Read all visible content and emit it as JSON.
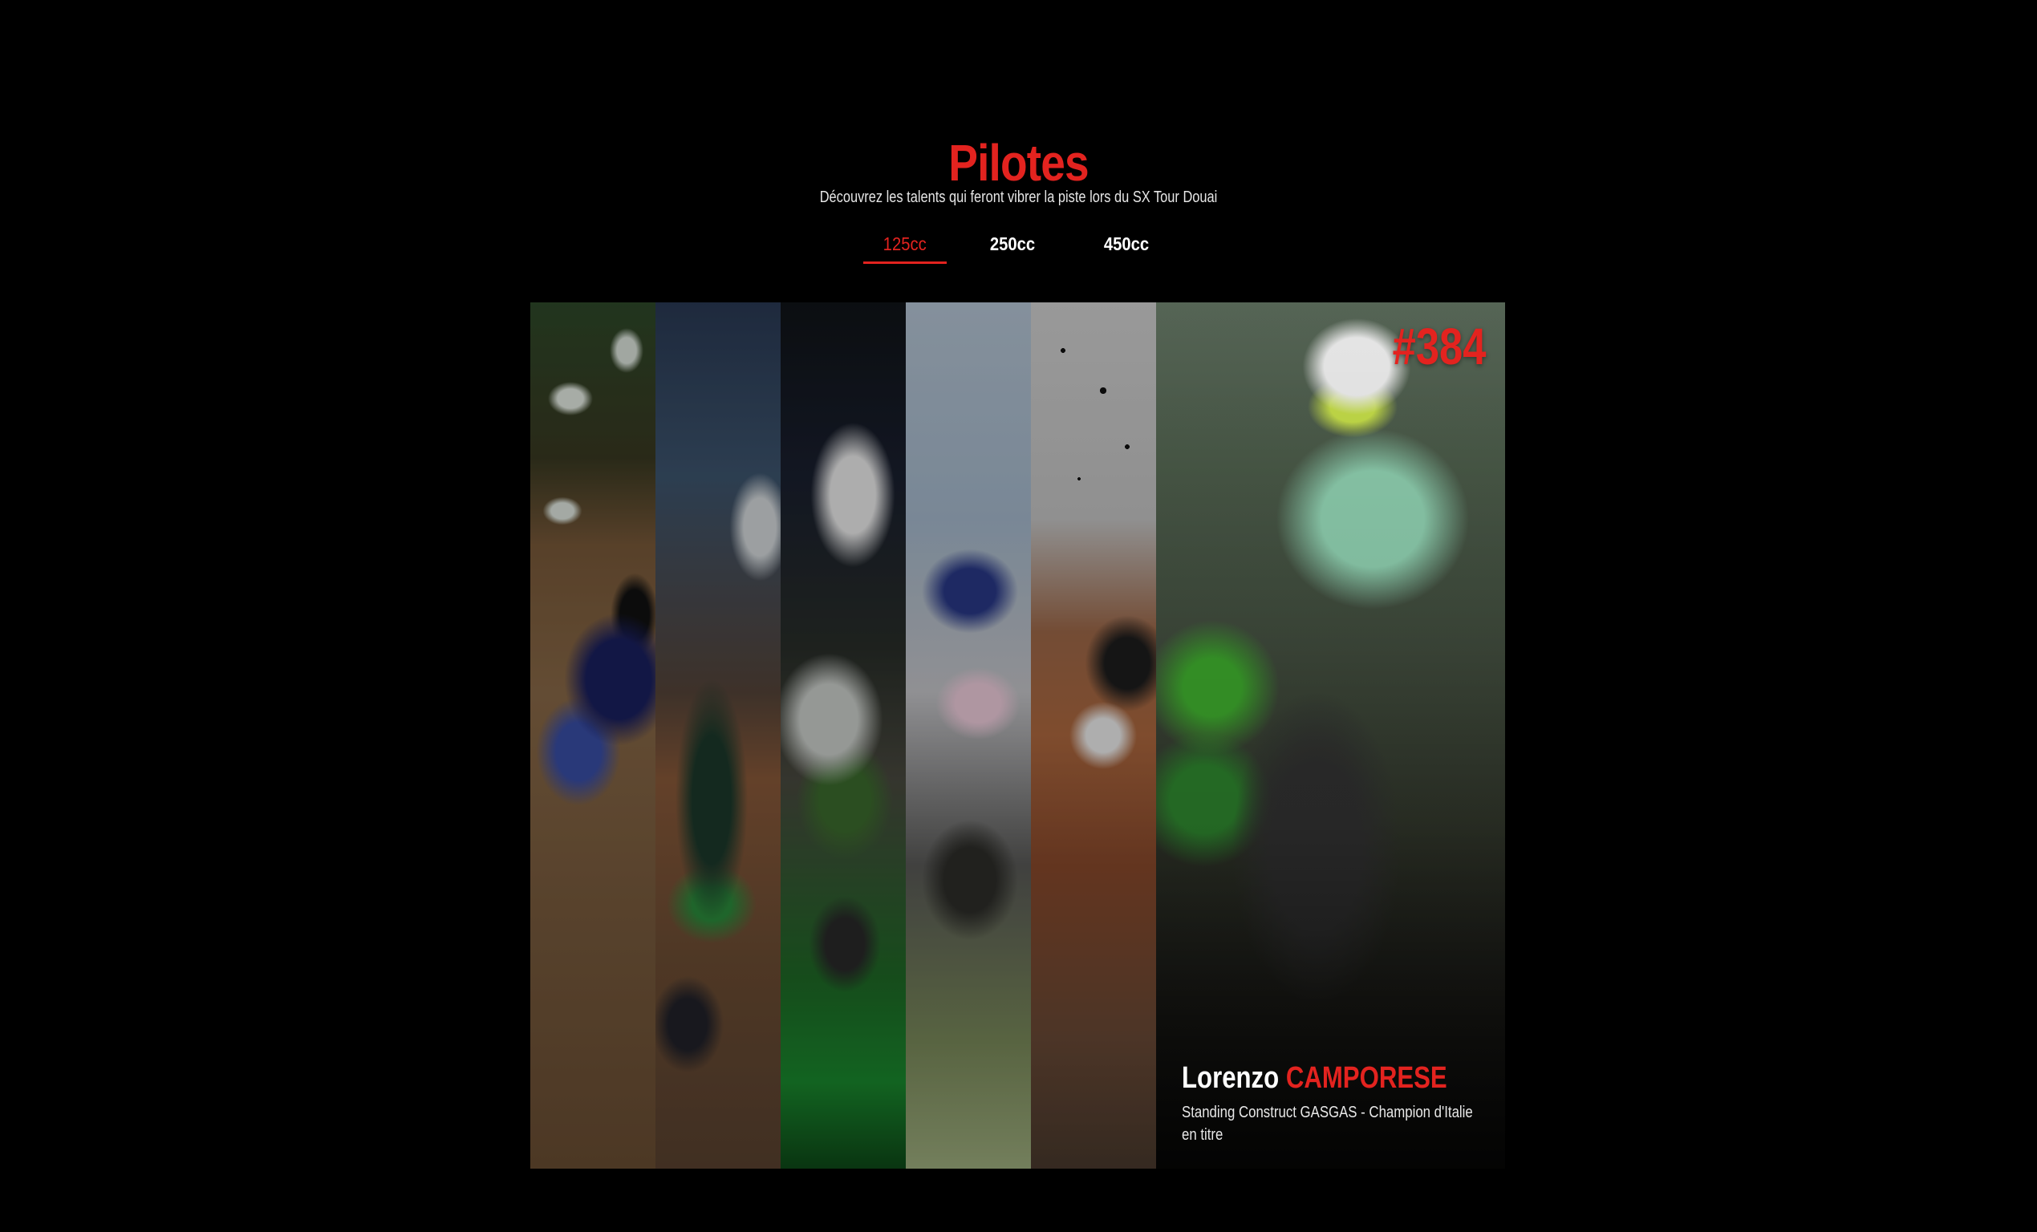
{
  "section": {
    "title": "Pilotes",
    "subtitle": "Découvrez les talents qui feront vibrer la piste lors du SX Tour Douai"
  },
  "tabs": [
    {
      "label": "125cc",
      "active": true
    },
    {
      "label": "250cc",
      "active": false
    },
    {
      "label": "450cc",
      "active": false
    }
  ],
  "colors": {
    "accent": "#e3231f",
    "background": "#000000",
    "text": "#ffffff"
  },
  "featured_rider": {
    "number": "#384",
    "first_name": "Lorenzo",
    "last_name": "CAMPORESE",
    "description": "Standing Construct GASGAS - Champion d'Italie en titre"
  }
}
